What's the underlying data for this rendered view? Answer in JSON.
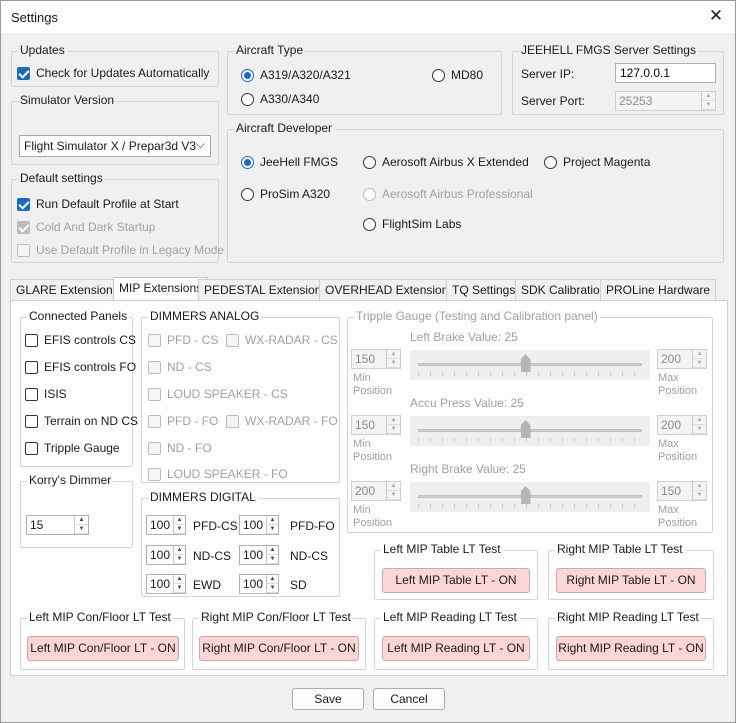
{
  "window": {
    "title": "Settings"
  },
  "updates": {
    "legend": "Updates",
    "check_label": "Check for Updates Automatically"
  },
  "simulator": {
    "legend": "Simulator Version",
    "selected": "Flight Simulator X / Prepar3d V3"
  },
  "defaults": {
    "legend": "Default settings",
    "run_default": "Run Default Profile at Start",
    "cold_dark": "Cold And Dark Startup",
    "legacy": "Use Default Profile in Legacy Mode"
  },
  "aircraft_type": {
    "legend": "Aircraft Type",
    "a319": "A319/A320/A321",
    "md80": "MD80",
    "a330": "A330/A340"
  },
  "server": {
    "legend": "JEEHELL FMGS Server Settings",
    "ip_label": "Server IP:",
    "ip_value": "127.0.0.1",
    "port_label": "Server Port:",
    "port_value": "25253"
  },
  "developer": {
    "legend": "Aircraft Developer",
    "jeehell": "JeeHell FMGS",
    "aerosoft_ext": "Aerosoft Airbus X Extended",
    "magenta": "Project Magenta",
    "prosim": "ProSim A320",
    "aerosoft_pro": "Aerosoft Airbus Professional",
    "flightsim": "FlightSim Labs"
  },
  "tabs": [
    "GLARE Extensions",
    "MIP Extensions",
    "PEDESTAL Extensions",
    "OVERHEAD Extensions",
    "TQ Settings",
    "SDK Calibration",
    "PROLine Hardware"
  ],
  "connected": {
    "legend": "Connected Panels",
    "items": [
      "EFIS controls CS",
      "EFIS controls FO",
      "ISIS",
      "Terrain on ND CS",
      "Tripple Gauge"
    ]
  },
  "korry": {
    "legend": "Korry's Dimmer",
    "value": "15"
  },
  "dimmers_analog": {
    "legend": "DIMMERS ANALOG",
    "pfd_cs": "PFD - CS",
    "wx_cs": "WX-RADAR - CS",
    "nd_cs": "ND - CS",
    "loud_cs": "LOUD SPEAKER - CS",
    "pfd_fo": "PFD - FO",
    "wx_fo": "WX-RADAR - FO",
    "nd_fo": "ND - FO",
    "loud_fo": "LOUD SPEAKER - FO"
  },
  "dimmers_digital": {
    "legend": "DIMMERS DIGITAL",
    "rows": [
      {
        "v1": "100",
        "l1": "PFD-CS",
        "v2": "100",
        "l2": "PFD-FO"
      },
      {
        "v1": "100",
        "l1": "ND-CS",
        "v2": "100",
        "l2": "ND-CS"
      },
      {
        "v1": "100",
        "l1": "EWD",
        "v2": "100",
        "l2": "SD"
      }
    ]
  },
  "tripple": {
    "legend": "Tripple Gauge (Testing and Calibration panel)",
    "min_label": "Min Position",
    "max_label": "Max Position",
    "left_brake": {
      "title": "Left Brake Value: 25",
      "min": "150",
      "max": "200",
      "position": 0.48
    },
    "accu": {
      "title": "Accu Press Value: 25",
      "min": "150",
      "max": "200",
      "position": 0.48
    },
    "right_brake": {
      "title": "Right Brake Value: 25",
      "min": "200",
      "max": "150",
      "position": 0.48
    }
  },
  "lt_tests": {
    "left_table": {
      "legend": "Left MIP Table LT Test",
      "button": "Left MIP Table LT - ON"
    },
    "right_table": {
      "legend": "Right MIP Table LT Test",
      "button": "Right MIP Table LT - ON"
    },
    "left_con": {
      "legend": "Left MIP Con/Floor LT Test",
      "button": "Left MIP Con/Floor LT - ON"
    },
    "right_con": {
      "legend": "Right MIP Con/Floor LT Test",
      "button": "Right MIP Con/Floor LT - ON"
    },
    "left_read": {
      "legend": "Left MIP Reading LT Test",
      "button": "Left MIP Reading LT - ON"
    },
    "right_read": {
      "legend": "Right MIP Reading LT Test",
      "button": "Right MIP Reading LT - ON"
    }
  },
  "footer": {
    "save": "Save",
    "cancel": "Cancel"
  },
  "icons": {
    "close": "close-icon",
    "chevron": "chevron-down-icon",
    "spin": "spin-arrows-icon"
  },
  "colors": {
    "accent": "#1a6bc4",
    "lt_button": "#fcd6d6"
  }
}
